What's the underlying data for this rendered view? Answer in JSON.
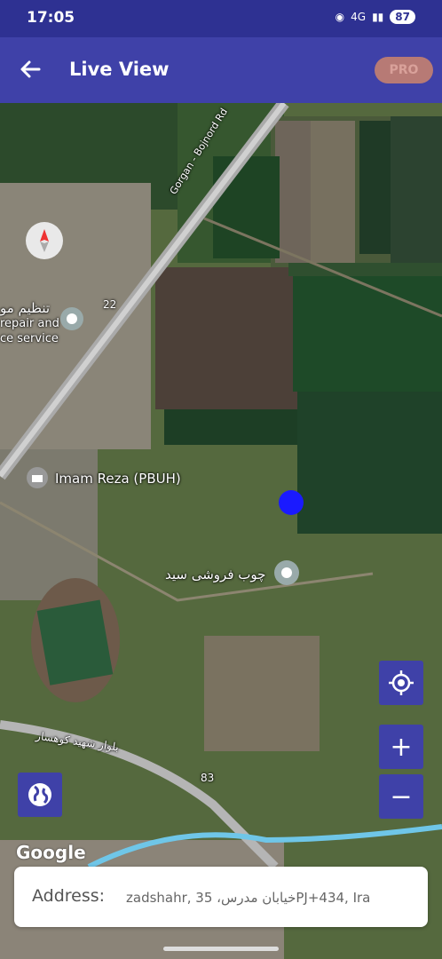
{
  "status_bar": {
    "time": "17:05",
    "battery": "87",
    "network": "4G"
  },
  "app_bar": {
    "title": "Live View",
    "pro_label": "PRO"
  },
  "map": {
    "road_label_gorgan": "Gorgan - Bojnord Rd",
    "road_number_22": "22",
    "road_number_83": "83",
    "poi_repair_arabic": "تنظیم مو",
    "poi_repair_line1": "repair and",
    "poi_repair_line2": "ce service",
    "poi_imam": "Imam Reza (PBUH)",
    "poi_wood": "چوب فروشی سید",
    "street_arabic": "بلوار شهید کوهسار",
    "google": "Google"
  },
  "address": {
    "label": "Address:",
    "value": "zadshahr, 35 ،خیابان مدرس‌PJ+434, Ira"
  },
  "colors": {
    "app_bar": "#3f41a8",
    "status_bar": "#2e3192",
    "marker": "#1a1aff"
  }
}
